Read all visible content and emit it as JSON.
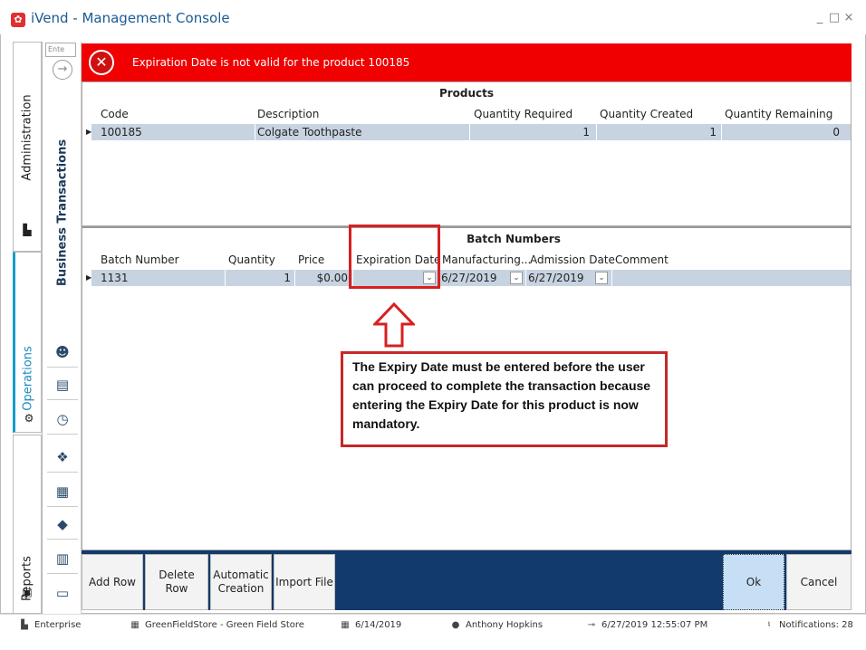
{
  "window": {
    "title": "iVend - Management Console",
    "controls": [
      "_",
      "□",
      "×"
    ]
  },
  "left_nav": {
    "tabs": [
      {
        "label": "Administration",
        "icon": "building-icon"
      },
      {
        "label": "Operations",
        "icon": "gear-icon"
      },
      {
        "label": "Reports",
        "icon": "report-icon"
      }
    ]
  },
  "sub_nav": {
    "search_placeholder": "Ente",
    "section_label": "Business Transactions",
    "icons": [
      "coin-person-icon",
      "cash-register-icon",
      "clock-icon",
      "gift-icon",
      "warehouse-icon",
      "tag-icon",
      "store-icon",
      "card-icon"
    ]
  },
  "error": {
    "message": "Expiration Date is not valid for the product 100185"
  },
  "products": {
    "title": "Products",
    "columns": [
      "Code",
      "Description",
      "Quantity Required",
      "Quantity Created",
      "Quantity Remaining"
    ],
    "rows": [
      {
        "code": "100185",
        "description": "Colgate Toothpaste",
        "qty_required": "1",
        "qty_created": "1",
        "qty_remaining": "0"
      }
    ]
  },
  "batch": {
    "title": "Batch Numbers",
    "columns": [
      "Batch Number",
      "Quantity",
      "Price",
      "Expiration Date",
      "Manufacturing...",
      "Admission Date",
      "Comment"
    ],
    "rows": [
      {
        "batch_number": "1131",
        "quantity": "1",
        "price": "$0.00",
        "expiration_date": "",
        "manufacturing": "6/27/2019",
        "admission": "6/27/2019",
        "comment": ""
      }
    ]
  },
  "annotation": {
    "note": "The Expiry Date must be entered before the user can proceed to complete the transaction because entering the Expiry Date for this product is now mandatory."
  },
  "toolbar": {
    "add_row": "Add Row",
    "delete_row": "Delete Row",
    "automatic_creation": "Automatic Creation",
    "import_file": "Import File",
    "ok": "Ok",
    "cancel": "Cancel"
  },
  "status": {
    "enterprise": "Enterprise",
    "store": "GreenFieldStore - Green Field Store",
    "date": "6/14/2019",
    "user": "Anthony Hopkins",
    "datetime": "6/27/2019 12:55:07 PM",
    "notifications": "Notifications: 28"
  },
  "colors": {
    "error": "#f00000",
    "toolbar": "#123a6a",
    "selected_row": "#c7d3e1",
    "annotation": "#d72020"
  }
}
